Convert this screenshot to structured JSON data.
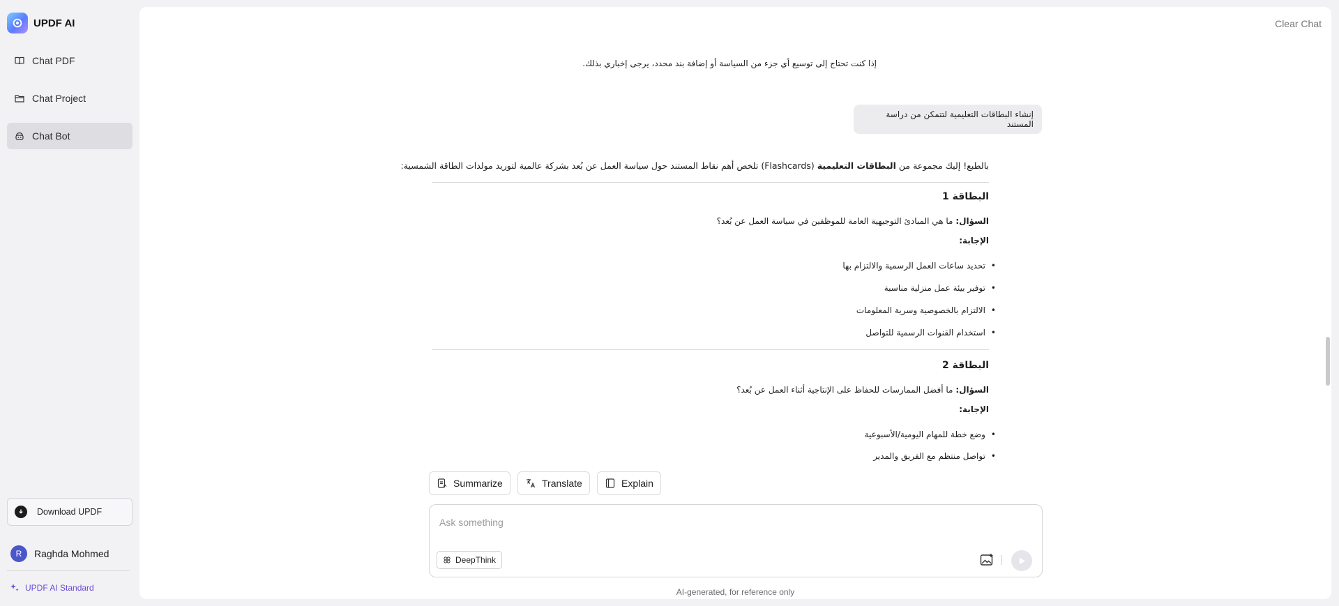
{
  "brand": {
    "name": "UPDF AI"
  },
  "sidebar": {
    "items": [
      {
        "label": "Chat PDF",
        "icon": "book-icon"
      },
      {
        "label": "Chat Project",
        "icon": "folder-icon"
      },
      {
        "label": "Chat Bot",
        "icon": "bot-icon",
        "active": true
      }
    ],
    "download_label": "Download UPDF",
    "user": {
      "initial": "R",
      "name": "Raghda Mohmed"
    },
    "plan": "UPDF AI Standard"
  },
  "header": {
    "clear_chat": "Clear Chat"
  },
  "chat": {
    "prev_tail": "إذا كنت تحتاج إلى توسيع أي جزء من السياسة أو إضافة بند محدد، يرجى إخباري بذلك.",
    "user_message": "إنشاء البطاقات التعليمية لتتمكن من دراسة المستند",
    "intro_pre": "بالطبع! إليك مجموعة من ",
    "intro_bold": "البطاقات التعليمية",
    "intro_post": " (Flashcards) تلخص أهم نقاط المستند حول سياسة العمل عن بُعد بشركة عالمية لتوريد مولدات الطاقة الشمسية:",
    "cards": [
      {
        "title": "البطاقة 1",
        "q_label": "السؤال:",
        "question": " ما هي المبادئ التوجيهية العامة للموظفين في سياسة العمل عن بُعد؟",
        "a_label": "الإجابة:",
        "answers": [
          "تحديد ساعات العمل الرسمية والالتزام بها",
          "توفير بيئة عمل منزلية مناسبة",
          "الالتزام بالخصوصية وسرية المعلومات",
          "استخدام القنوات الرسمية للتواصل"
        ]
      },
      {
        "title": "البطاقة 2",
        "q_label": "السؤال:",
        "question": " ما أفضل الممارسات للحفاظ على الإنتاجية أثناء العمل عن بُعد؟",
        "a_label": "الإجابة:",
        "answers": [
          "وضع خطة للمهام اليومية/الأسبوعية",
          "تواصل منتظم مع الفريق والمدير"
        ]
      }
    ]
  },
  "actions": {
    "summarize": "Summarize",
    "translate": "Translate",
    "explain": "Explain"
  },
  "input": {
    "placeholder": "Ask something",
    "deepthink": "DeepThink"
  },
  "footer": {
    "disclaimer": "AI-generated, for reference only"
  }
}
